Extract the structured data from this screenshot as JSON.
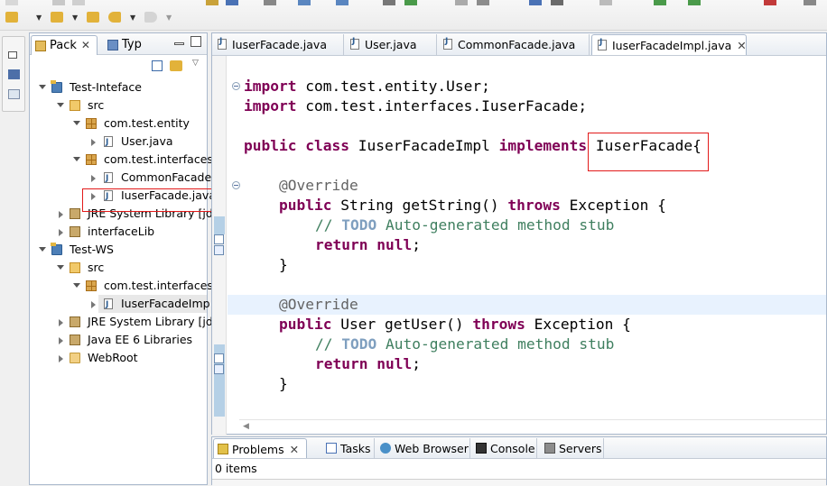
{
  "package_explorer": {
    "tabs": [
      {
        "label": "Pack",
        "close": "✕"
      },
      {
        "label": "Typ",
        "close": ""
      }
    ],
    "tree": [
      {
        "label": "Test-Inteface"
      },
      {
        "label": "src"
      },
      {
        "label": "com.test.entity"
      },
      {
        "label": "User.java"
      },
      {
        "label": "com.test.interfaces"
      },
      {
        "label": "CommonFacade"
      },
      {
        "label": "IuserFacade.java"
      },
      {
        "label": "JRE System Library [jdk"
      },
      {
        "label": "interfaceLib"
      },
      {
        "label": "Test-WS"
      },
      {
        "label": "src"
      },
      {
        "label": "com.test.interfacesI"
      },
      {
        "label": "IuserFacadeImp"
      },
      {
        "label": "JRE System Library [jdk"
      },
      {
        "label": "Java EE 6 Libraries"
      },
      {
        "label": "WebRoot"
      }
    ]
  },
  "editor": {
    "tabs": [
      {
        "label": "IuserFacade.java"
      },
      {
        "label": "User.java"
      },
      {
        "label": "CommonFacade.java"
      },
      {
        "label": "IuserFacadeImpl.java",
        "close": "✕"
      }
    ],
    "code": {
      "l1_kw": "import",
      "l1_rest": " com.test.entity.User;",
      "l2_kw": "import",
      "l2_rest": " com.test.interfaces.IuserFacade;",
      "l3_kw1": "public",
      "l3_kw2": "class",
      "l3_name": " IuserFacadeImpl ",
      "l3_kw3": "implements",
      "l3_iface": " IuserFacade{",
      "l4_ann": "@Override",
      "l5_kw1": "public",
      "l5_mid": " String getString() ",
      "l5_kw2": "throws",
      "l5_rest": " Exception {",
      "l6_cm1": "// ",
      "l6_todo": "TODO",
      "l6_cm2": " Auto-generated method stub",
      "l7_kw1": "return",
      "l7_kw2": " null",
      "l7_rest": ";",
      "l8": "}",
      "l9_ann": "@Override",
      "l10_kw1": "public",
      "l10_mid": " User getUser() ",
      "l10_kw2": "throws",
      "l10_rest": " Exception {",
      "l11_cm1": "// ",
      "l11_todo": "TODO",
      "l11_cm2": " Auto-generated method stub",
      "l12_kw1": "return",
      "l12_kw2": " null",
      "l12_rest": ";",
      "l13": "}"
    }
  },
  "bottom_panel": {
    "tabs": [
      {
        "label": "Problems",
        "close": "✕"
      },
      {
        "label": "Tasks"
      },
      {
        "label": "Web Browser"
      },
      {
        "label": "Console"
      },
      {
        "label": "Servers"
      }
    ],
    "status": "0 items"
  },
  "colors": {
    "keyword": "#7f0055",
    "annotation": "#646464",
    "comment": "#3f7f5f",
    "todo": "#7f9fbf",
    "highlight_box": "#e21a1a"
  }
}
